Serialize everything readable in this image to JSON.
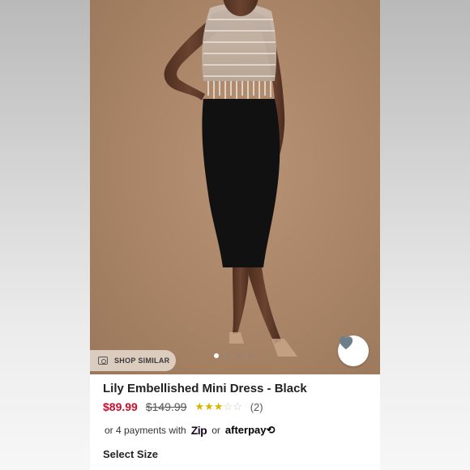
{
  "product": {
    "title": "Lily Embellished Mini Dress - Black",
    "sale_price": "$89.99",
    "original_price": "$149.99",
    "rating": 3,
    "rating_max": 5,
    "review_count": "(2)"
  },
  "gallery": {
    "shop_similar_label": "SHOP SIMILAR",
    "image_count": 4,
    "active_index": 0
  },
  "payment": {
    "prefix": "or 4 payments with",
    "zip_label": "Zip",
    "or_label": "or",
    "afterpay_label": "afterpay"
  },
  "size": {
    "heading": "Select Size"
  },
  "colors": {
    "sale_red": "#c8102e",
    "star_gold": "#d9b400",
    "heart": "#6d7f8c"
  }
}
